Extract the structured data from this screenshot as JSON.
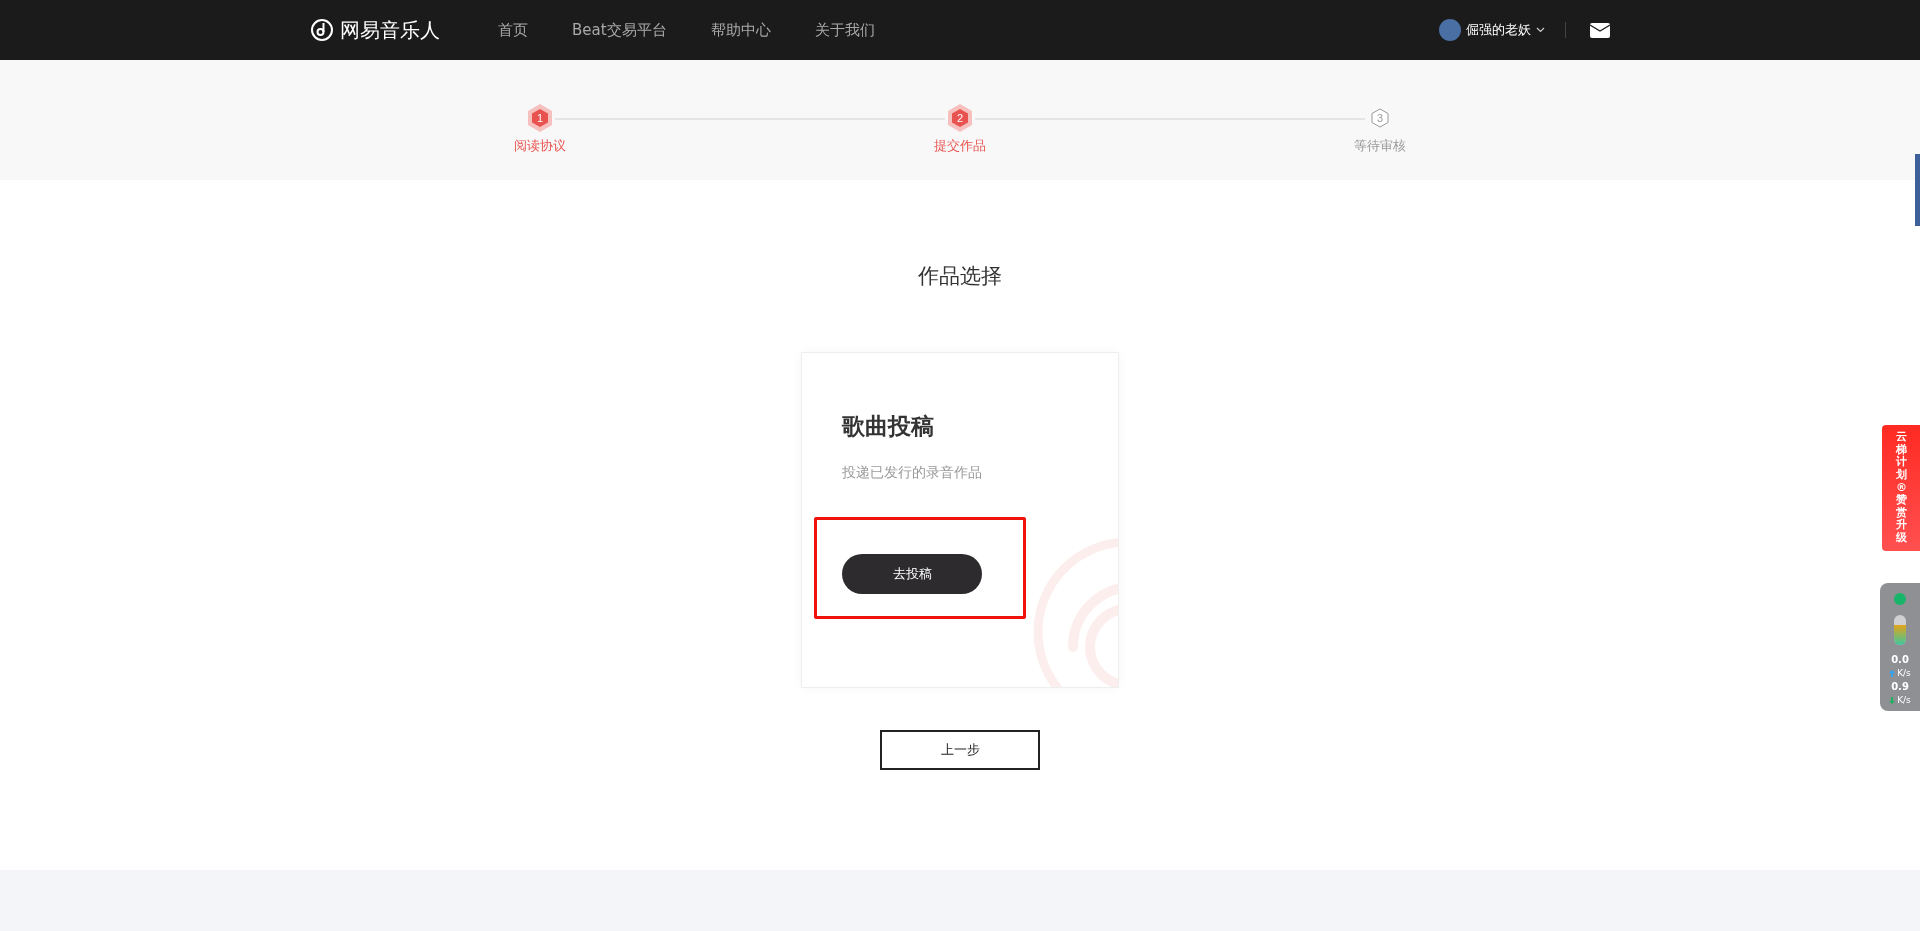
{
  "header": {
    "logo": "网易音乐人",
    "nav": [
      {
        "label": "首页"
      },
      {
        "label": "Beat交易平台"
      },
      {
        "label": "帮助中心"
      },
      {
        "label": "关于我们"
      }
    ],
    "user": {
      "name": "倔强的老妖"
    }
  },
  "steps": [
    {
      "number": "1",
      "label": "阅读协议",
      "active": true
    },
    {
      "number": "2",
      "label": "提交作品",
      "active": true
    },
    {
      "number": "3",
      "label": "等待审核",
      "active": false
    }
  ],
  "section_title": "作品选择",
  "card": {
    "title": "歌曲投稿",
    "description": "投递已发行的录音作品",
    "button": "去投稿"
  },
  "back_button": "上一步",
  "side_promo": "云梯计划®赞赏升级",
  "speed_widget": {
    "upload": "0.0",
    "upload_unit": "K/s",
    "download": "0.9",
    "download_unit": "K/s"
  }
}
